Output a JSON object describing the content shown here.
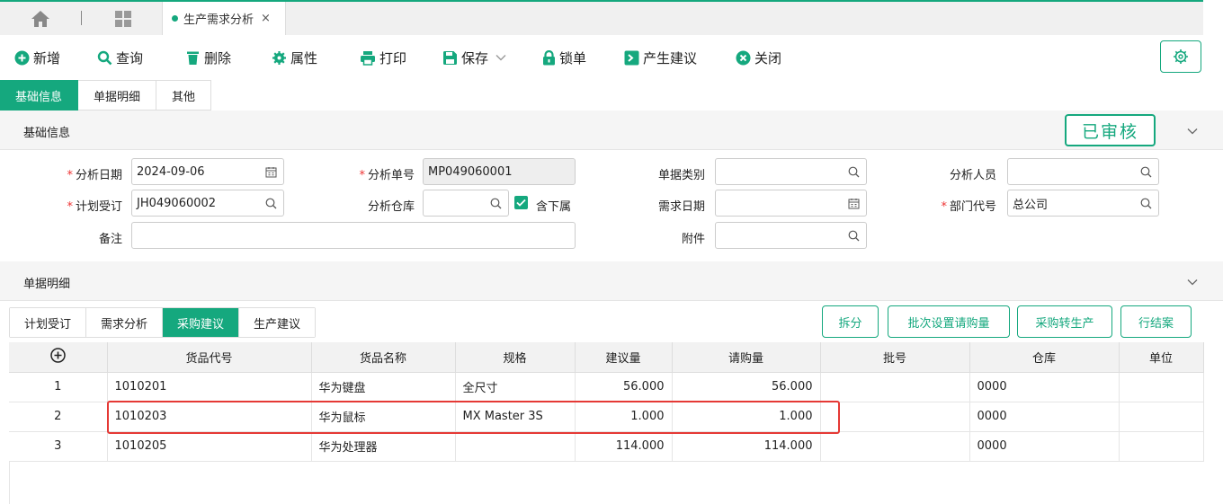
{
  "tabbar": {
    "doc_tab_label": "生产需求分析",
    "close_glyph": "×"
  },
  "toolbar": {
    "new": "新增",
    "query": "查询",
    "delete": "删除",
    "properties": "属性",
    "print": "打印",
    "save": "保存",
    "lock": "锁单",
    "generate": "产生建议",
    "close": "关闭"
  },
  "page_tabs": [
    "基础信息",
    "单据明细",
    "其他"
  ],
  "basic": {
    "section_title": "基础信息",
    "status_stamp": "已审核",
    "labels": {
      "analysis_date": "分析日期",
      "analysis_no": "分析单号",
      "doc_type": "单据类别",
      "analyst": "分析人员",
      "plan_order": "计划受订",
      "analysis_wh": "分析仓库",
      "include_sub": "含下属",
      "demand_date": "需求日期",
      "dept_code": "部门代号",
      "remark": "备注",
      "attachment": "附件"
    },
    "values": {
      "analysis_date": "2024-09-06",
      "analysis_no": "MP049060001",
      "doc_type": "",
      "analyst": "",
      "plan_order": "JH049060002",
      "analysis_wh": "",
      "include_sub_checked": true,
      "demand_date": "",
      "dept_code": "总公司",
      "remark": "",
      "attachment": ""
    }
  },
  "detail": {
    "section_title": "单据明细",
    "tabs": [
      "计划受订",
      "需求分析",
      "采购建议",
      "生产建议"
    ],
    "active_tab": "采购建议",
    "actions": [
      "拆分",
      "批次设置请购量",
      "采购转生产",
      "行结案"
    ],
    "columns": [
      "货品代号",
      "货品名称",
      "规格",
      "建议量",
      "请购量",
      "批号",
      "仓库",
      "单位"
    ],
    "rows": [
      {
        "no": "1",
        "code": "1010201",
        "name": "华为键盘",
        "spec": "全尺寸",
        "suggest": "56.000",
        "request": "56.000",
        "batch": "",
        "wh": "0000",
        "unit": ""
      },
      {
        "no": "2",
        "code": "1010203",
        "name": "华为鼠标",
        "spec": "MX Master 3S",
        "suggest": "1.000",
        "request": "1.000",
        "batch": "",
        "wh": "0000",
        "unit": ""
      },
      {
        "no": "3",
        "code": "1010205",
        "name": "华为处理器",
        "spec": "",
        "suggest": "114.000",
        "request": "114.000",
        "batch": "",
        "wh": "0000",
        "unit": ""
      }
    ],
    "highlighted_row": "2"
  },
  "colors": {
    "accent": "#15a87e",
    "highlight": "#e53935"
  }
}
